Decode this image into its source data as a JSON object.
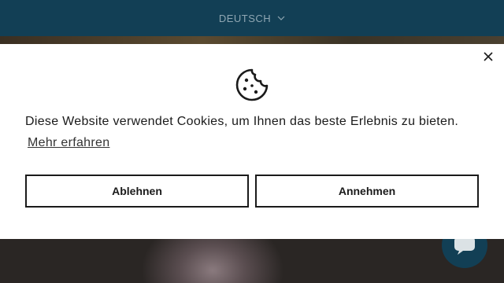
{
  "header": {
    "language_label": "DEUTSCH",
    "language_icon": "chevron-down-icon",
    "bar_color": "#123f55"
  },
  "cookie_banner": {
    "icon": "cookie-icon",
    "close_icon": "close-icon",
    "message": "Diese Website verwendet Cookies, um Ihnen das beste Erlebnis zu bieten.",
    "learn_more_label": "Mehr erfahren",
    "decline_label": "Ablehnen",
    "accept_label": "Annehmen"
  },
  "chat_widget": {
    "icon": "chat-icon",
    "color": "#123f55"
  }
}
